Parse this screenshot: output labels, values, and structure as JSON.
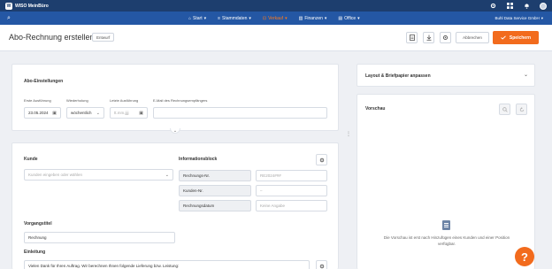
{
  "app": {
    "logo_letter": "W",
    "title": "WISO MeinBüro"
  },
  "titlebar_icons": [
    "gear-icon",
    "grid-icon",
    "bell-icon",
    "avatar"
  ],
  "nav": {
    "search_icon": "⌕",
    "items": [
      {
        "icon": "home-icon",
        "glyph": "⌂",
        "label": "Start"
      },
      {
        "icon": "database-icon",
        "glyph": "≡",
        "label": "Stammdaten"
      },
      {
        "icon": "cart-icon",
        "glyph": "⊡",
        "label": "Verkauf"
      },
      {
        "icon": "bank-icon",
        "glyph": "▥",
        "label": "Finanzen"
      },
      {
        "icon": "office-icon",
        "glyph": "▤",
        "label": "Office"
      }
    ],
    "chevron": "▾",
    "company": "Buhl Data Service GmbH",
    "company_chevron": "▾",
    "active_color": "#ff7a1a"
  },
  "header": {
    "title": "Abo-Rechnung erstellen",
    "badge": "Entwurf",
    "abort_label": "Abbrechen",
    "save_label": "Speichern",
    "save_color": "#f26b1d"
  },
  "abo": {
    "title": "Abo-Einstellungen",
    "first_label": "Erste Ausführung",
    "first_value": "23.05.2024",
    "repeat_label": "Wiederholung",
    "repeat_value": "wöchentlich",
    "last_label": "Letzte Ausführung",
    "last_value": "tt.mm.jjjj",
    "email_label": "E-Mail des Rechnungsempfängers",
    "email_value": ""
  },
  "kunde": {
    "title": "Kunde",
    "placeholder": "Kunden eingeben oder wählen"
  },
  "info": {
    "title": "Informationsblock",
    "rows": [
      {
        "label": "Rechnungs-Nr.",
        "value": "RE2024###"
      },
      {
        "label": "Kunden-Nr.",
        "value": "–"
      },
      {
        "label": "Rechnungsdatum",
        "value": "Keine Angabe"
      }
    ]
  },
  "vorgang": {
    "title": "Vorgangstitel",
    "value": "Rechnung"
  },
  "einleitung": {
    "title": "Einleitung",
    "value": "Vielen Dank für Ihren Auftrag. Wir berechnen Ihnen folgende Lieferung bzw. Leistung:"
  },
  "layout_panel": {
    "title": "Layout & Briefpapier anpassen"
  },
  "preview": {
    "title": "Vorschau",
    "empty_text": "Die Vorschau ist erst nach Hinzufügen eines Kunden und einer Position verfügbar."
  },
  "help": {
    "label": "?"
  }
}
